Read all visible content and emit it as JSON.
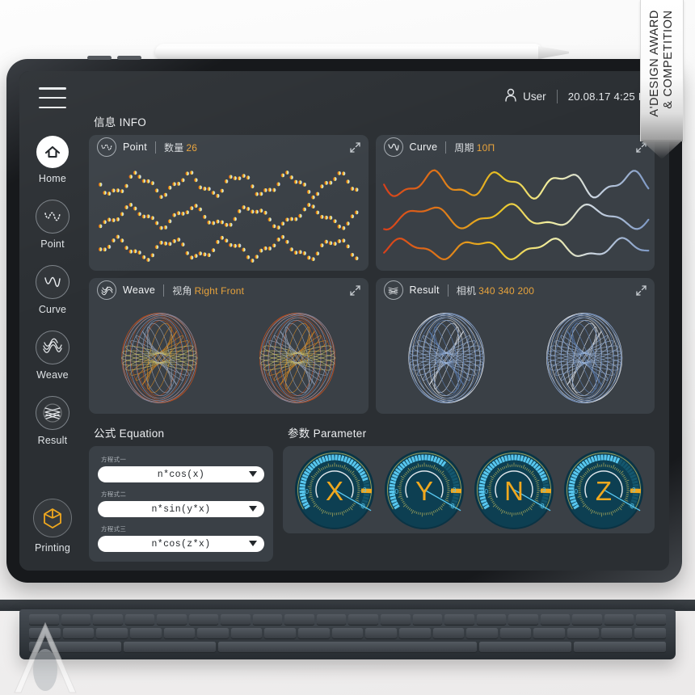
{
  "award_badge": {
    "line1": "A'DESIGN AWARD",
    "line2": "& COMPETITION"
  },
  "topbar": {
    "user_icon": "user-icon",
    "user_label": "User",
    "datetime": "20.08.17 4:25 PM",
    "menu_icon": "hamburger-menu-icon"
  },
  "sidebar": {
    "items": [
      {
        "label": "Home",
        "icon": "home-icon",
        "active": true
      },
      {
        "label": "Point",
        "icon": "point-icon",
        "active": false
      },
      {
        "label": "Curve",
        "icon": "curve-icon",
        "active": false
      },
      {
        "label": "Weave",
        "icon": "weave-icon",
        "active": false
      },
      {
        "label": "Result",
        "icon": "result-icon",
        "active": false
      },
      {
        "label": "Printing",
        "icon": "printing-cube-icon",
        "active": false
      }
    ]
  },
  "info": {
    "section_title": "信息 INFO",
    "panels": [
      {
        "name": "Point",
        "icon": "point-icon",
        "meta_label": "数量",
        "meta_value": "26",
        "expand_icon": "expand-diagonal-icon"
      },
      {
        "name": "Curve",
        "icon": "curve-icon",
        "meta_label": "周期",
        "meta_value": "10Π",
        "expand_icon": "expand-diagonal-icon"
      },
      {
        "name": "Weave",
        "icon": "weave-icon",
        "meta_label": "视角",
        "meta_value": "Right  Front",
        "expand_icon": "expand-diagonal-icon"
      },
      {
        "name": "Result",
        "icon": "result-icon",
        "meta_label": "相机",
        "meta_value": "340  340  200",
        "expand_icon": "expand-diagonal-icon"
      }
    ]
  },
  "equation": {
    "section_title": "公式 Equation",
    "rows": [
      {
        "label": "方程式一",
        "value": "n*cos(x)"
      },
      {
        "label": "方程式二",
        "value": "n*sin(y*x)"
      },
      {
        "label": "方程式三",
        "value": "n*cos(z*x)"
      }
    ],
    "caret_icon": "chevron-down-icon"
  },
  "parameter": {
    "section_title": "参数 Parameter",
    "gauges": [
      {
        "letter": "X",
        "min_label": "30",
        "mid_label": "3",
        "max_label": "0",
        "needle_deg": 92,
        "value_arc": 0.8
      },
      {
        "letter": "Y",
        "min_label": "30",
        "mid_label": "3",
        "max_label": "0",
        "needle_deg": 92,
        "value_arc": 0.66
      },
      {
        "letter": "N",
        "min_label": "30",
        "mid_label": "3",
        "max_label": "0",
        "needle_deg": 92,
        "value_arc": 0.8
      },
      {
        "letter": "Z",
        "min_label": "30",
        "mid_label": "3",
        "max_label": "0",
        "needle_deg": 92,
        "value_arc": 0.62
      }
    ],
    "colors": {
      "dial": "#0d3f52",
      "bar": "#57c6ee",
      "tick": "#b8b35a",
      "pointer": "#f0a81e",
      "letter": "#f0a81e"
    }
  },
  "chart_data": [
    {
      "type": "scatter",
      "title": "Point",
      "description": "Three horizontal rows of sampled sine points, colour-graded left→right",
      "rows": 3,
      "points_per_row": 60,
      "gradient": [
        "#d9401a",
        "#e07a18",
        "#e8c424",
        "#f2ee9e",
        "#cfd8e2",
        "#7f9ac6"
      ],
      "grid": false,
      "legend": "none"
    },
    {
      "type": "line",
      "title": "Curve",
      "description": "Three sinusoidal curves, colour-graded left→right, period 10Π",
      "series": [
        {
          "name": "curve-1",
          "amplitude": 22,
          "frequency": 4.0
        },
        {
          "name": "curve-2",
          "amplitude": 20,
          "frequency": 3.2
        },
        {
          "name": "curve-3",
          "amplitude": 17,
          "frequency": 3.6
        }
      ],
      "gradient": [
        "#d9401a",
        "#e07a18",
        "#e8c424",
        "#f2ee9e",
        "#cfd8e2",
        "#7f9ac6"
      ],
      "grid": false,
      "legend": "none"
    },
    {
      "type": "line",
      "title": "Weave",
      "description": "Two Lissajous wireframe views (Right, Front) in warm gradient",
      "views": [
        "Right",
        "Front"
      ],
      "loops": 26,
      "gradient": [
        "#c4501f",
        "#d98b22",
        "#ddd06a",
        "#9aa6bb",
        "#8ea0c4"
      ],
      "grid": false,
      "legend": "none"
    },
    {
      "type": "line",
      "title": "Result",
      "description": "Two 3D wireframe renders of the woven solid, camera 340 340 200",
      "views": [
        "view-1",
        "view-2"
      ],
      "loops": 26,
      "gradient": [
        "#e8eef8",
        "#9fb8de",
        "#5e82bb"
      ],
      "grid": false,
      "legend": "none"
    }
  ]
}
